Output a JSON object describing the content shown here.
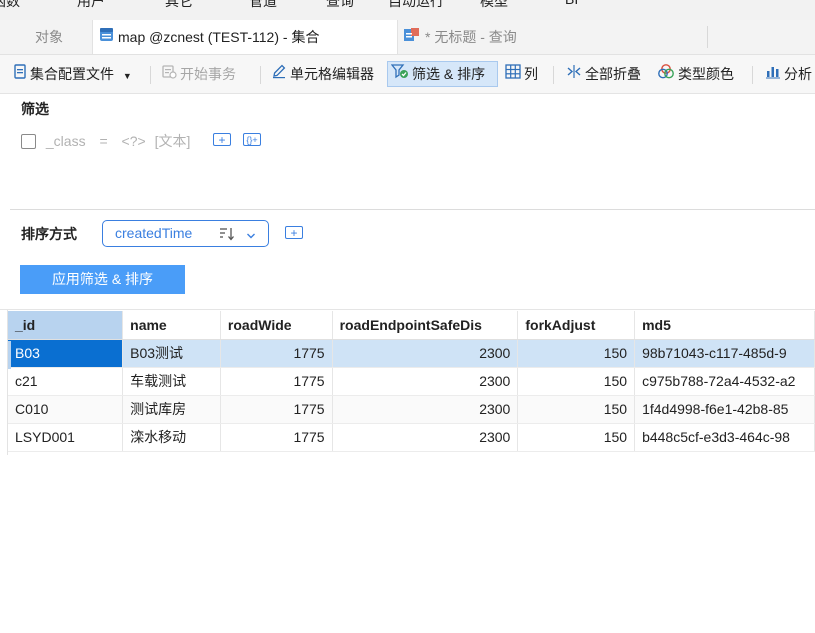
{
  "menu": [
    "函数",
    "用户",
    "其它",
    "管道",
    "查询",
    "自动运行",
    "模型",
    "BI"
  ],
  "tabs": [
    {
      "label": "对象",
      "active": false
    },
    {
      "label": "map @zcnest (TEST-112) - 集合",
      "active": true
    },
    {
      "label": "* 无标题 - 查询",
      "active": false
    }
  ],
  "toolbar": {
    "config": "集合配置文件",
    "begin_tx": "开始事务",
    "cell_editor": "单元格编辑器",
    "filter_sort": "筛选 & 排序",
    "columns": "列",
    "collapse_all": "全部折叠",
    "type_color": "类型颜色",
    "analyze": "分析"
  },
  "filter": {
    "title": "筛选",
    "field": "_class",
    "operator": "=",
    "value": "<?>",
    "type": "[文本]",
    "add": "+",
    "add_group": "{}+"
  },
  "sort": {
    "title": "排序方式",
    "field": "createdTime",
    "order_icon": "sort-desc-icon",
    "add": "+"
  },
  "apply_label": "应用筛选 & 排序",
  "colors": {
    "accent": "#3a7fe0",
    "apply": "#4a9df8",
    "selected_cell": "#0a6fd1",
    "selected_row": "#cfe3f6"
  },
  "grid": {
    "columns": [
      "_id",
      "name",
      "roadWide",
      "roadEndpointSafeDis",
      "forkAdjust",
      "md5"
    ],
    "rows": [
      [
        "B03",
        "B03测试",
        "1775",
        "2300",
        "150",
        "98b71043-c117-485d-9"
      ],
      [
        "c21",
        "车载测试",
        "1775",
        "2300",
        "150",
        "c975b788-72a4-4532-a2"
      ],
      [
        "C010",
        "测试库房",
        "1775",
        "2300",
        "150",
        "1f4d4998-f6e1-42b8-85"
      ],
      [
        "LSYD001",
        "滦水移动",
        "1775",
        "2300",
        "150",
        "b448c5cf-e3d3-464c-98"
      ]
    ]
  }
}
